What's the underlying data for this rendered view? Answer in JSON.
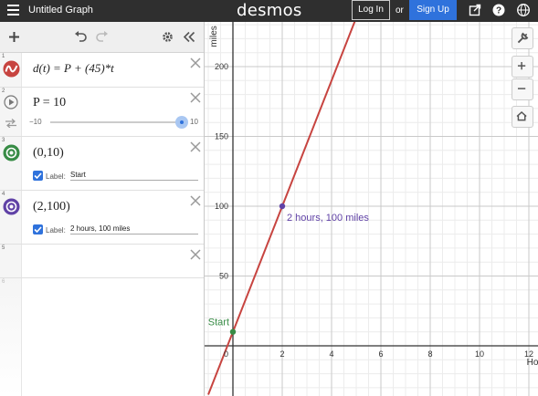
{
  "header": {
    "graph_title": "Untitled Graph",
    "logo": "desmos",
    "login_label": "Log In",
    "or_text": "or",
    "signup_label": "Sign Up"
  },
  "expressions": [
    {
      "index": "1",
      "latex_display": "d(t) = P + (45)*t",
      "color": "#c74440",
      "icon": "wave-icon"
    },
    {
      "index": "2",
      "latex_display": "P = 10",
      "slider_min": "−10",
      "slider_max": "10",
      "slider_value_fraction": 1.0
    },
    {
      "index": "3",
      "latex_display": "(0,10)",
      "color": "#388c46",
      "label_caption": "Label:",
      "label_value": "Start"
    },
    {
      "index": "4",
      "latex_display": "(2,100)",
      "color": "#6042a6",
      "label_caption": "Label:",
      "label_value": "2 hours, 100 miles"
    },
    {
      "index": "5",
      "latex_display": ""
    },
    {
      "index": "6",
      "latex_display": ""
    }
  ],
  "colors": {
    "line": "#c74440",
    "start_point": "#388c46",
    "point_two": "#6042a6",
    "accent": "#2f72dc"
  },
  "chart_data": {
    "type": "line",
    "xlabel": "Hours",
    "ylabel": "miles",
    "x_ticks": [
      "2",
      "4",
      "6",
      "8",
      "10",
      "12"
    ],
    "y_ticks": [
      "50",
      "100",
      "150",
      "200"
    ],
    "origin_label": "0",
    "xlim": [
      -2,
      12
    ],
    "ylim": [
      -20,
      230
    ],
    "grid": true,
    "series": [
      {
        "equation": "d(t) = 10 + 45t",
        "points": [
          [
            -1,
            -35
          ],
          [
            5,
            235
          ]
        ]
      }
    ],
    "points": [
      {
        "x": 0,
        "y": 10,
        "label": "Start"
      },
      {
        "x": 2,
        "y": 100,
        "label": "2 hours, 100 miles"
      }
    ]
  }
}
